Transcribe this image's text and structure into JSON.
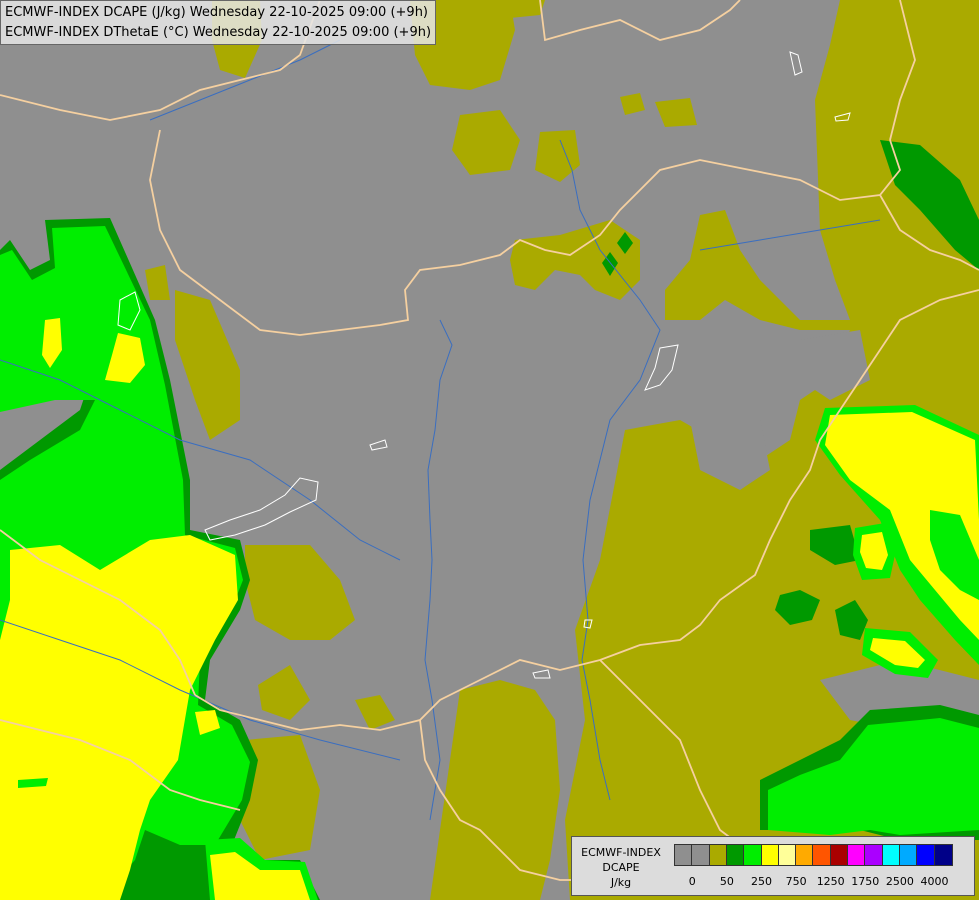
{
  "title": {
    "line1": "ECMWF-INDEX DCAPE (J/kg) Wednesday 22-10-2025 09:00 (+9h)",
    "line2": "ECMWF-INDEX DThetaE (°C) Wednesday 22-10-2025 09:00 (+9h)"
  },
  "legend": {
    "title_line1": "ECMWF-INDEX",
    "title_line2": "DCAPE",
    "unit": "J/kg",
    "colors": [
      "#8f8f8f",
      "#8f8f8f",
      "#aaaa00",
      "#009900",
      "#00ee00",
      "#ffff00",
      "#ffff99",
      "#ffaa00",
      "#ff5500",
      "#aa0000",
      "#ff00ff",
      "#aa00ff",
      "#00ffff",
      "#00aaff",
      "#0000ff",
      "#000088"
    ],
    "ticks": [
      "0",
      "50",
      "250",
      "750",
      "1250",
      "1750",
      "2500",
      "4000"
    ]
  },
  "map_colors": {
    "background": "#8f8f8f",
    "olive": "#aaaa00",
    "dark_green": "#009900",
    "green": "#00ee00",
    "yellow": "#ffff00",
    "border_line": "#f5d0a0",
    "river": "#3a6ec0",
    "lake": "#ffffff"
  }
}
